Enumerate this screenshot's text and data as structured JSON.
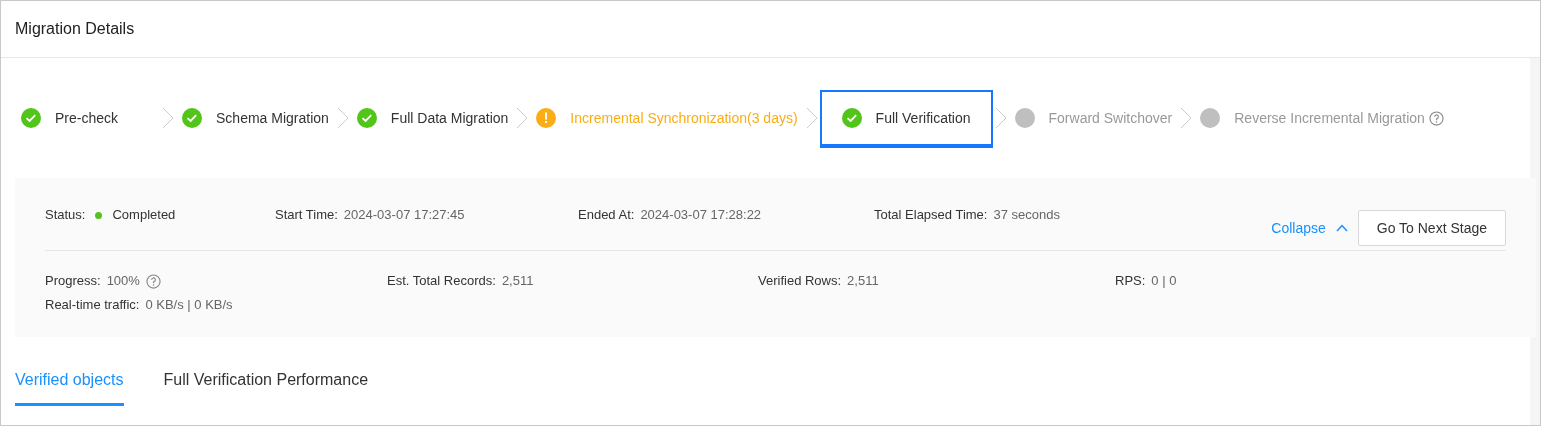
{
  "title": "Migration Details",
  "steps": [
    {
      "label": "Pre-check",
      "kind": "done",
      "selected": false
    },
    {
      "label": "Schema Migration",
      "kind": "done",
      "selected": false
    },
    {
      "label": "Full Data Migration",
      "kind": "done",
      "selected": false
    },
    {
      "label": "Incremental Synchronization(3 days)",
      "kind": "warning",
      "selected": false
    },
    {
      "label": "Full Verification",
      "kind": "done",
      "selected": true
    },
    {
      "label": "Forward Switchover",
      "kind": "pending",
      "selected": false
    },
    {
      "label": "Reverse Incremental Migration",
      "kind": "pending",
      "selected": false,
      "help": true
    }
  ],
  "summary": [
    {
      "label": "Status:",
      "value": "Completed",
      "color": "#52c41a"
    },
    {
      "label": "Start Time:",
      "value": "2024-03-07 17:27:45"
    },
    {
      "label": "Ended At:",
      "value": "2024-03-07 17:28:22"
    },
    {
      "label": "Total Elapsed Time:",
      "value": "37 seconds"
    }
  ],
  "collapse": "Collapse",
  "next_button": "Go To Next Stage",
  "metrics": [
    {
      "label": "Progress:",
      "value": "100%",
      "help": true
    },
    {
      "label": "Est. Total Records:",
      "value": "2,511"
    },
    {
      "label": "Verified Rows:",
      "value": "2,511"
    },
    {
      "label": "RPS:",
      "value": "0 | 0"
    }
  ],
  "traffic": {
    "label": "Real-time traffic:",
    "value": "0 KB/s | 0 KB/s"
  },
  "tabs": [
    {
      "label": "Verified objects",
      "selected": true
    },
    {
      "label": "Full Verification Performance",
      "selected": false
    }
  ]
}
